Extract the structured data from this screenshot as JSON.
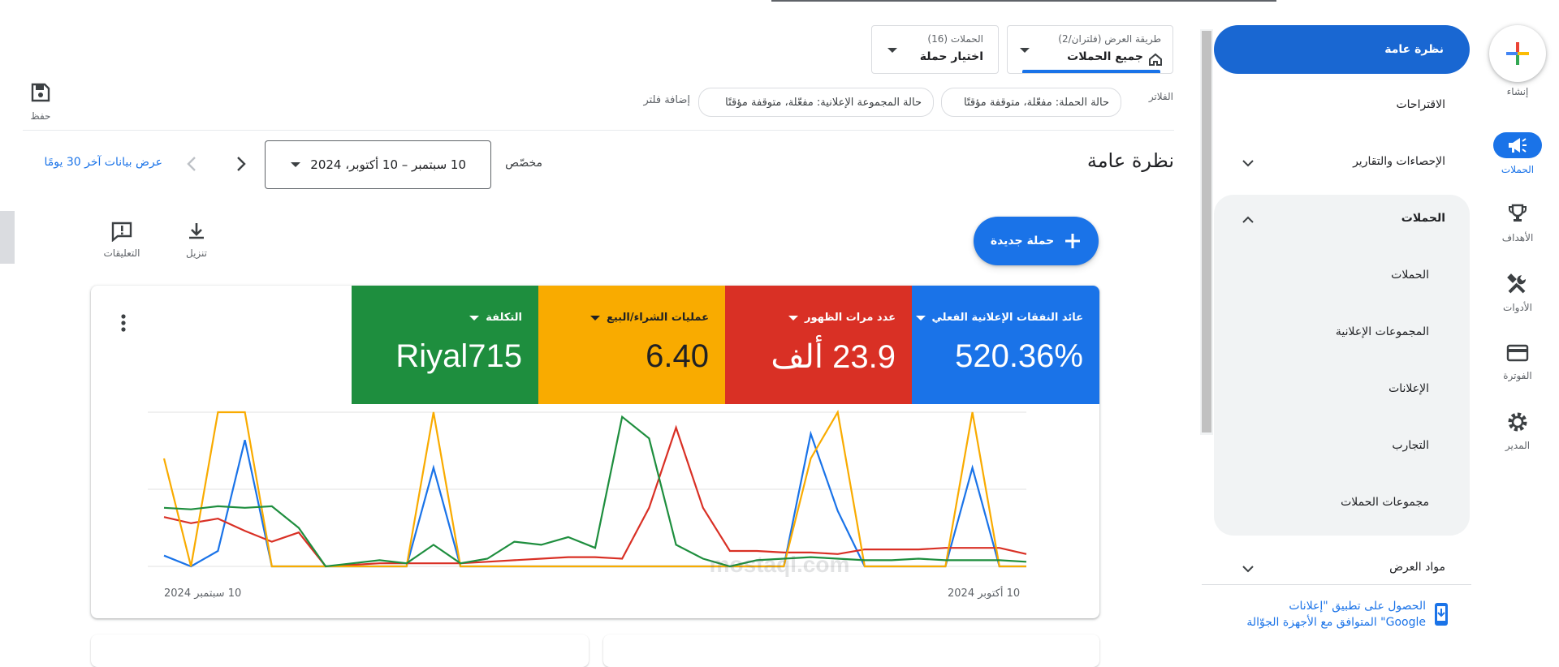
{
  "rail": {
    "create_label": "إنشاء",
    "items": [
      {
        "label": "الحملات",
        "icon": "megaphone-icon",
        "active": true
      },
      {
        "label": "الأهداف",
        "icon": "trophy-icon"
      },
      {
        "label": "الأدوات",
        "icon": "tools-icon"
      },
      {
        "label": "الفوترة",
        "icon": "credit-card-icon"
      },
      {
        "label": "المدير",
        "icon": "gear-icon"
      }
    ]
  },
  "nav": {
    "overview": "نظرة عامة",
    "recommendations": "الاقتراحات",
    "insights_reports": "الإحصاءات والتقارير",
    "campaigns_group": "الحملات",
    "sub_items": [
      "الحملات",
      "المجموعات الإعلانية",
      "الإعلانات",
      "التجارب",
      "مجموعات الحملات"
    ],
    "assets": "مواد العرض",
    "app_promo_line1": "الحصول على تطبيق \"إعلانات",
    "app_promo_line2": "Google\" المتوافق مع الأجهزة الجوّالة"
  },
  "header": {
    "view_selector_label": "طريقة العرض (فلتران/2)",
    "view_selector_value": "جميع الحملات",
    "campaign_selector_label": "الحملات (16)",
    "campaign_selector_value": "اختيار حملة",
    "save_label": "حفظ",
    "filters_label": "الفلاتر",
    "filter_chips": [
      "حالة الحملة: مفعّلة، متوقفة مؤقتًا",
      "حالة المجموعة الإعلانية: مفعّلة، متوقفة مؤقتًا"
    ],
    "add_filter": "إضافة فلتر"
  },
  "page": {
    "title": "نظرة عامة",
    "date_preset": "مخصّص",
    "date_range": "10 سبتمبر – 10 أكتوبر، 2024",
    "last30_link": "عرض بيانات آخر 30 يومًا",
    "new_campaign": "حملة جديدة",
    "download": "تنزيل",
    "feedback": "التعليقات"
  },
  "tiles": [
    {
      "label": "عائد النفقات الإعلانية الفعلي",
      "value": "520.36%",
      "color": "#1a73e8"
    },
    {
      "label": "عدد مرات الظهور",
      "value": "23.9 ألف",
      "color": "#d93025"
    },
    {
      "label": "عمليات الشراء/البيع",
      "value": "6.40",
      "color": "#f9ab00"
    },
    {
      "label": "التكلفة",
      "value": "Riyal715",
      "color": "#1e8e3e"
    }
  ],
  "chart_data": {
    "type": "line",
    "x_start_label": "10 سبتمبر 2024",
    "x_end_label": "10 أكتوبر 2024",
    "grid": true,
    "series": [
      {
        "name": "عائد النفقات الإعلانية الفعلي",
        "color": "#1a73e8",
        "values": [
          0.07,
          0.0,
          0.1,
          0.82,
          0.0,
          0.0,
          0.0,
          0.0,
          0.0,
          0.0,
          0.64,
          0.0,
          0.0,
          0.0,
          0.0,
          0.0,
          0.0,
          0.0,
          0.0,
          0.0,
          0.0,
          0.0,
          0.0,
          0.0,
          0.86,
          0.36,
          0.0,
          0.0,
          0.0,
          0.0,
          0.64,
          0.0,
          0.0
        ]
      },
      {
        "name": "عدد مرات الظهور",
        "color": "#d93025",
        "values": [
          0.32,
          0.28,
          0.31,
          0.23,
          0.16,
          0.22,
          0.0,
          0.01,
          0.02,
          0.02,
          0.02,
          0.02,
          0.03,
          0.04,
          0.05,
          0.06,
          0.06,
          0.05,
          0.38,
          0.9,
          0.38,
          0.1,
          0.1,
          0.09,
          0.09,
          0.08,
          0.11,
          0.11,
          0.11,
          0.12,
          0.12,
          0.12,
          0.08
        ]
      },
      {
        "name": "عمليات الشراء/البيع",
        "color": "#f9ab00",
        "values": [
          0.7,
          0.0,
          1.0,
          1.0,
          0.0,
          0.0,
          0.0,
          0.0,
          0.0,
          0.0,
          1.0,
          0.0,
          0.0,
          0.0,
          0.0,
          0.0,
          0.0,
          0.0,
          0.0,
          0.0,
          0.0,
          0.0,
          0.0,
          0.0,
          0.7,
          1.0,
          0.0,
          0.0,
          0.0,
          0.0,
          1.0,
          0.0,
          0.0
        ]
      },
      {
        "name": "التكلفة",
        "color": "#1e8e3e",
        "values": [
          0.38,
          0.37,
          0.39,
          0.38,
          0.39,
          0.25,
          0.0,
          0.02,
          0.04,
          0.02,
          0.14,
          0.02,
          0.05,
          0.16,
          0.14,
          0.19,
          0.12,
          0.97,
          0.83,
          0.14,
          0.05,
          0.0,
          0.04,
          0.05,
          0.06,
          0.05,
          0.04,
          0.04,
          0.05,
          0.04,
          0.04,
          0.04,
          0.03
        ]
      }
    ]
  },
  "watermark": "mostaql.com"
}
